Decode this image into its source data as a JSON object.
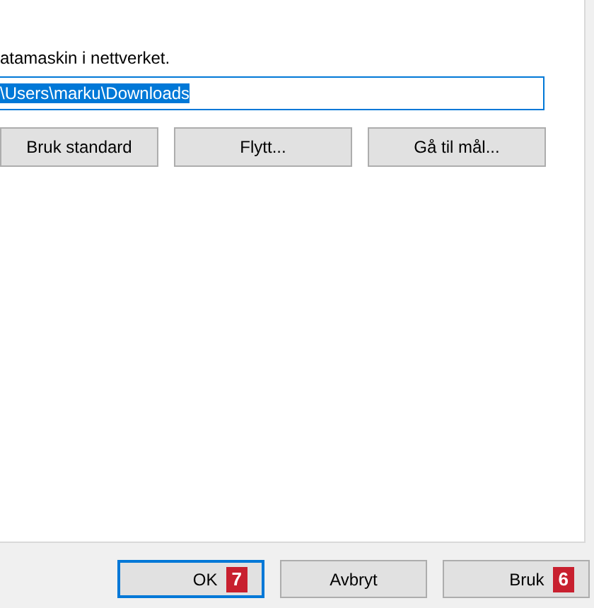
{
  "panel": {
    "description": "atamaskin i nettverket.",
    "path_field": {
      "value": "\\Users\\marku\\Downloads",
      "selected": true
    },
    "buttons": [
      {
        "label": "Bruk standard"
      },
      {
        "label": "Flytt..."
      },
      {
        "label": "Gå til mål..."
      }
    ]
  },
  "footer_buttons": [
    {
      "label": "OK",
      "default": true,
      "badge": "7"
    },
    {
      "label": "Avbryt",
      "default": false
    },
    {
      "label": "Bruk",
      "default": false,
      "badge": "6"
    }
  ]
}
